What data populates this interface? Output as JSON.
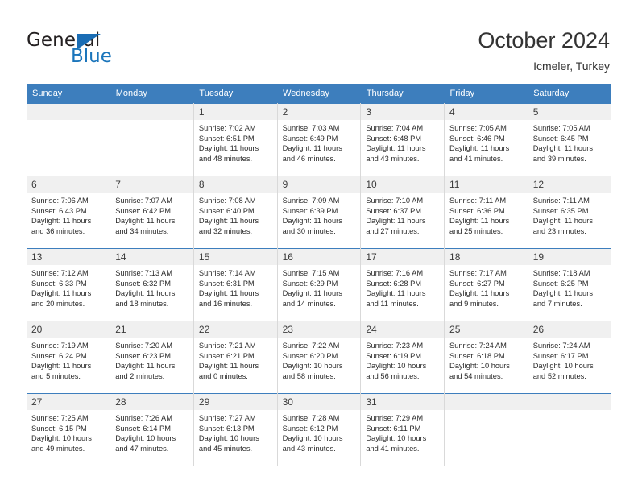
{
  "brand": {
    "name_top": "General",
    "name_bottom": "Blue",
    "accent_color": "#1b75bb",
    "triangle_color": "#1a6db5"
  },
  "header": {
    "title": "October 2024",
    "subtitle": "Icmeler, Turkey"
  },
  "theme": {
    "header_row_bg": "#3d7ebd",
    "header_row_text": "#ffffff",
    "daynum_band_bg": "#f0f0f0",
    "cell_border": "#d9d9d9",
    "week_divider": "#3d7ebd"
  },
  "columns": [
    "Sunday",
    "Monday",
    "Tuesday",
    "Wednesday",
    "Thursday",
    "Friday",
    "Saturday"
  ],
  "weeks": [
    [
      {
        "day": "",
        "sunrise": "",
        "sunset": "",
        "daylight1": "",
        "daylight2": ""
      },
      {
        "day": "",
        "sunrise": "",
        "sunset": "",
        "daylight1": "",
        "daylight2": ""
      },
      {
        "day": "1",
        "sunrise": "Sunrise: 7:02 AM",
        "sunset": "Sunset: 6:51 PM",
        "daylight1": "Daylight: 11 hours",
        "daylight2": "and 48 minutes."
      },
      {
        "day": "2",
        "sunrise": "Sunrise: 7:03 AM",
        "sunset": "Sunset: 6:49 PM",
        "daylight1": "Daylight: 11 hours",
        "daylight2": "and 46 minutes."
      },
      {
        "day": "3",
        "sunrise": "Sunrise: 7:04 AM",
        "sunset": "Sunset: 6:48 PM",
        "daylight1": "Daylight: 11 hours",
        "daylight2": "and 43 minutes."
      },
      {
        "day": "4",
        "sunrise": "Sunrise: 7:05 AM",
        "sunset": "Sunset: 6:46 PM",
        "daylight1": "Daylight: 11 hours",
        "daylight2": "and 41 minutes."
      },
      {
        "day": "5",
        "sunrise": "Sunrise: 7:05 AM",
        "sunset": "Sunset: 6:45 PM",
        "daylight1": "Daylight: 11 hours",
        "daylight2": "and 39 minutes."
      }
    ],
    [
      {
        "day": "6",
        "sunrise": "Sunrise: 7:06 AM",
        "sunset": "Sunset: 6:43 PM",
        "daylight1": "Daylight: 11 hours",
        "daylight2": "and 36 minutes."
      },
      {
        "day": "7",
        "sunrise": "Sunrise: 7:07 AM",
        "sunset": "Sunset: 6:42 PM",
        "daylight1": "Daylight: 11 hours",
        "daylight2": "and 34 minutes."
      },
      {
        "day": "8",
        "sunrise": "Sunrise: 7:08 AM",
        "sunset": "Sunset: 6:40 PM",
        "daylight1": "Daylight: 11 hours",
        "daylight2": "and 32 minutes."
      },
      {
        "day": "9",
        "sunrise": "Sunrise: 7:09 AM",
        "sunset": "Sunset: 6:39 PM",
        "daylight1": "Daylight: 11 hours",
        "daylight2": "and 30 minutes."
      },
      {
        "day": "10",
        "sunrise": "Sunrise: 7:10 AM",
        "sunset": "Sunset: 6:37 PM",
        "daylight1": "Daylight: 11 hours",
        "daylight2": "and 27 minutes."
      },
      {
        "day": "11",
        "sunrise": "Sunrise: 7:11 AM",
        "sunset": "Sunset: 6:36 PM",
        "daylight1": "Daylight: 11 hours",
        "daylight2": "and 25 minutes."
      },
      {
        "day": "12",
        "sunrise": "Sunrise: 7:11 AM",
        "sunset": "Sunset: 6:35 PM",
        "daylight1": "Daylight: 11 hours",
        "daylight2": "and 23 minutes."
      }
    ],
    [
      {
        "day": "13",
        "sunrise": "Sunrise: 7:12 AM",
        "sunset": "Sunset: 6:33 PM",
        "daylight1": "Daylight: 11 hours",
        "daylight2": "and 20 minutes."
      },
      {
        "day": "14",
        "sunrise": "Sunrise: 7:13 AM",
        "sunset": "Sunset: 6:32 PM",
        "daylight1": "Daylight: 11 hours",
        "daylight2": "and 18 minutes."
      },
      {
        "day": "15",
        "sunrise": "Sunrise: 7:14 AM",
        "sunset": "Sunset: 6:31 PM",
        "daylight1": "Daylight: 11 hours",
        "daylight2": "and 16 minutes."
      },
      {
        "day": "16",
        "sunrise": "Sunrise: 7:15 AM",
        "sunset": "Sunset: 6:29 PM",
        "daylight1": "Daylight: 11 hours",
        "daylight2": "and 14 minutes."
      },
      {
        "day": "17",
        "sunrise": "Sunrise: 7:16 AM",
        "sunset": "Sunset: 6:28 PM",
        "daylight1": "Daylight: 11 hours",
        "daylight2": "and 11 minutes."
      },
      {
        "day": "18",
        "sunrise": "Sunrise: 7:17 AM",
        "sunset": "Sunset: 6:27 PM",
        "daylight1": "Daylight: 11 hours",
        "daylight2": "and 9 minutes."
      },
      {
        "day": "19",
        "sunrise": "Sunrise: 7:18 AM",
        "sunset": "Sunset: 6:25 PM",
        "daylight1": "Daylight: 11 hours",
        "daylight2": "and 7 minutes."
      }
    ],
    [
      {
        "day": "20",
        "sunrise": "Sunrise: 7:19 AM",
        "sunset": "Sunset: 6:24 PM",
        "daylight1": "Daylight: 11 hours",
        "daylight2": "and 5 minutes."
      },
      {
        "day": "21",
        "sunrise": "Sunrise: 7:20 AM",
        "sunset": "Sunset: 6:23 PM",
        "daylight1": "Daylight: 11 hours",
        "daylight2": "and 2 minutes."
      },
      {
        "day": "22",
        "sunrise": "Sunrise: 7:21 AM",
        "sunset": "Sunset: 6:21 PM",
        "daylight1": "Daylight: 11 hours",
        "daylight2": "and 0 minutes."
      },
      {
        "day": "23",
        "sunrise": "Sunrise: 7:22 AM",
        "sunset": "Sunset: 6:20 PM",
        "daylight1": "Daylight: 10 hours",
        "daylight2": "and 58 minutes."
      },
      {
        "day": "24",
        "sunrise": "Sunrise: 7:23 AM",
        "sunset": "Sunset: 6:19 PM",
        "daylight1": "Daylight: 10 hours",
        "daylight2": "and 56 minutes."
      },
      {
        "day": "25",
        "sunrise": "Sunrise: 7:24 AM",
        "sunset": "Sunset: 6:18 PM",
        "daylight1": "Daylight: 10 hours",
        "daylight2": "and 54 minutes."
      },
      {
        "day": "26",
        "sunrise": "Sunrise: 7:24 AM",
        "sunset": "Sunset: 6:17 PM",
        "daylight1": "Daylight: 10 hours",
        "daylight2": "and 52 minutes."
      }
    ],
    [
      {
        "day": "27",
        "sunrise": "Sunrise: 7:25 AM",
        "sunset": "Sunset: 6:15 PM",
        "daylight1": "Daylight: 10 hours",
        "daylight2": "and 49 minutes."
      },
      {
        "day": "28",
        "sunrise": "Sunrise: 7:26 AM",
        "sunset": "Sunset: 6:14 PM",
        "daylight1": "Daylight: 10 hours",
        "daylight2": "and 47 minutes."
      },
      {
        "day": "29",
        "sunrise": "Sunrise: 7:27 AM",
        "sunset": "Sunset: 6:13 PM",
        "daylight1": "Daylight: 10 hours",
        "daylight2": "and 45 minutes."
      },
      {
        "day": "30",
        "sunrise": "Sunrise: 7:28 AM",
        "sunset": "Sunset: 6:12 PM",
        "daylight1": "Daylight: 10 hours",
        "daylight2": "and 43 minutes."
      },
      {
        "day": "31",
        "sunrise": "Sunrise: 7:29 AM",
        "sunset": "Sunset: 6:11 PM",
        "daylight1": "Daylight: 10 hours",
        "daylight2": "and 41 minutes."
      },
      {
        "day": "",
        "sunrise": "",
        "sunset": "",
        "daylight1": "",
        "daylight2": ""
      },
      {
        "day": "",
        "sunrise": "",
        "sunset": "",
        "daylight1": "",
        "daylight2": ""
      }
    ]
  ]
}
